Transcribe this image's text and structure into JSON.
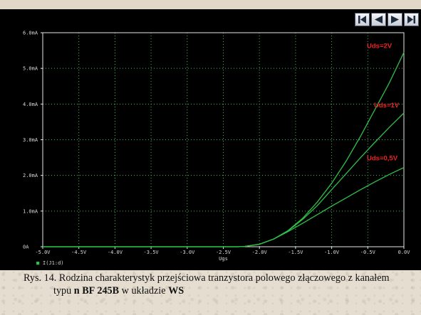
{
  "chart_data": {
    "type": "line",
    "xlabel": "Ugs",
    "ylabel": "",
    "x_ticks": [
      "-5.0V",
      "-4.5V",
      "-4.0V",
      "-3.5V",
      "-3.0V",
      "-2.5V",
      "-2.0V",
      "-1.5V",
      "-1.0V",
      "-0.5V",
      "0.0V"
    ],
    "y_ticks": [
      "0A",
      "1.0mA",
      "2.0mA",
      "3.0mA",
      "4.0mA",
      "5.0mA",
      "6.0mA"
    ],
    "xlim": [
      -5.0,
      0.0
    ],
    "ylim": [
      0,
      6.0
    ],
    "grid": true,
    "legend_marker": "■",
    "legend_text": "I(J1:d)",
    "series": [
      {
        "name": "Uds=2V",
        "color": "#2fbf4a",
        "points": [
          [
            -5.0,
            0
          ],
          [
            -2.3,
            0
          ],
          [
            -2.2,
            0.01
          ],
          [
            -2.0,
            0.07
          ],
          [
            -1.8,
            0.22
          ],
          [
            -1.6,
            0.46
          ],
          [
            -1.4,
            0.8
          ],
          [
            -1.2,
            1.25
          ],
          [
            -1.0,
            1.78
          ],
          [
            -0.8,
            2.4
          ],
          [
            -0.6,
            3.1
          ],
          [
            -0.4,
            3.85
          ],
          [
            -0.2,
            4.6
          ],
          [
            0.0,
            5.45
          ]
        ]
      },
      {
        "name": "Uds=1V",
        "color": "#2fbf4a",
        "points": [
          [
            -5.0,
            0
          ],
          [
            -2.3,
            0
          ],
          [
            -2.2,
            0.01
          ],
          [
            -2.0,
            0.07
          ],
          [
            -1.8,
            0.22
          ],
          [
            -1.6,
            0.45
          ],
          [
            -1.4,
            0.77
          ],
          [
            -1.2,
            1.15
          ],
          [
            -1.0,
            1.6
          ],
          [
            -0.8,
            2.05
          ],
          [
            -0.6,
            2.5
          ],
          [
            -0.4,
            2.93
          ],
          [
            -0.2,
            3.35
          ],
          [
            0.0,
            3.75
          ]
        ]
      },
      {
        "name": "Uds=0,5V",
        "color": "#2fbf4a",
        "points": [
          [
            -5.0,
            0
          ],
          [
            -2.3,
            0
          ],
          [
            -2.2,
            0.01
          ],
          [
            -2.0,
            0.07
          ],
          [
            -1.8,
            0.22
          ],
          [
            -1.6,
            0.43
          ],
          [
            -1.4,
            0.66
          ],
          [
            -1.2,
            0.9
          ],
          [
            -1.0,
            1.14
          ],
          [
            -0.8,
            1.37
          ],
          [
            -0.6,
            1.6
          ],
          [
            -0.4,
            1.82
          ],
          [
            -0.2,
            2.03
          ],
          [
            0.0,
            2.22
          ]
        ]
      }
    ]
  },
  "colors": {
    "background": "#000000",
    "grid": "#3fbf5a",
    "axes_text": "#d8d8d8",
    "series_label": "#ee2222",
    "curve": "#2fbf4a"
  },
  "navigation": {
    "first_icon": "skip-to-first-icon",
    "prev_icon": "previous-icon",
    "next_icon": "next-icon",
    "last_icon": "skip-to-last-icon"
  },
  "caption": {
    "line1": "Rys. 14. Rodzina charakterystyk przejściowa tranzystora polowego złączowego z kanałem",
    "line2_pre": "typu ",
    "line2_bold1": "n BF 245B",
    "line2_mid": " w układzie ",
    "line2_bold2": "WS"
  }
}
